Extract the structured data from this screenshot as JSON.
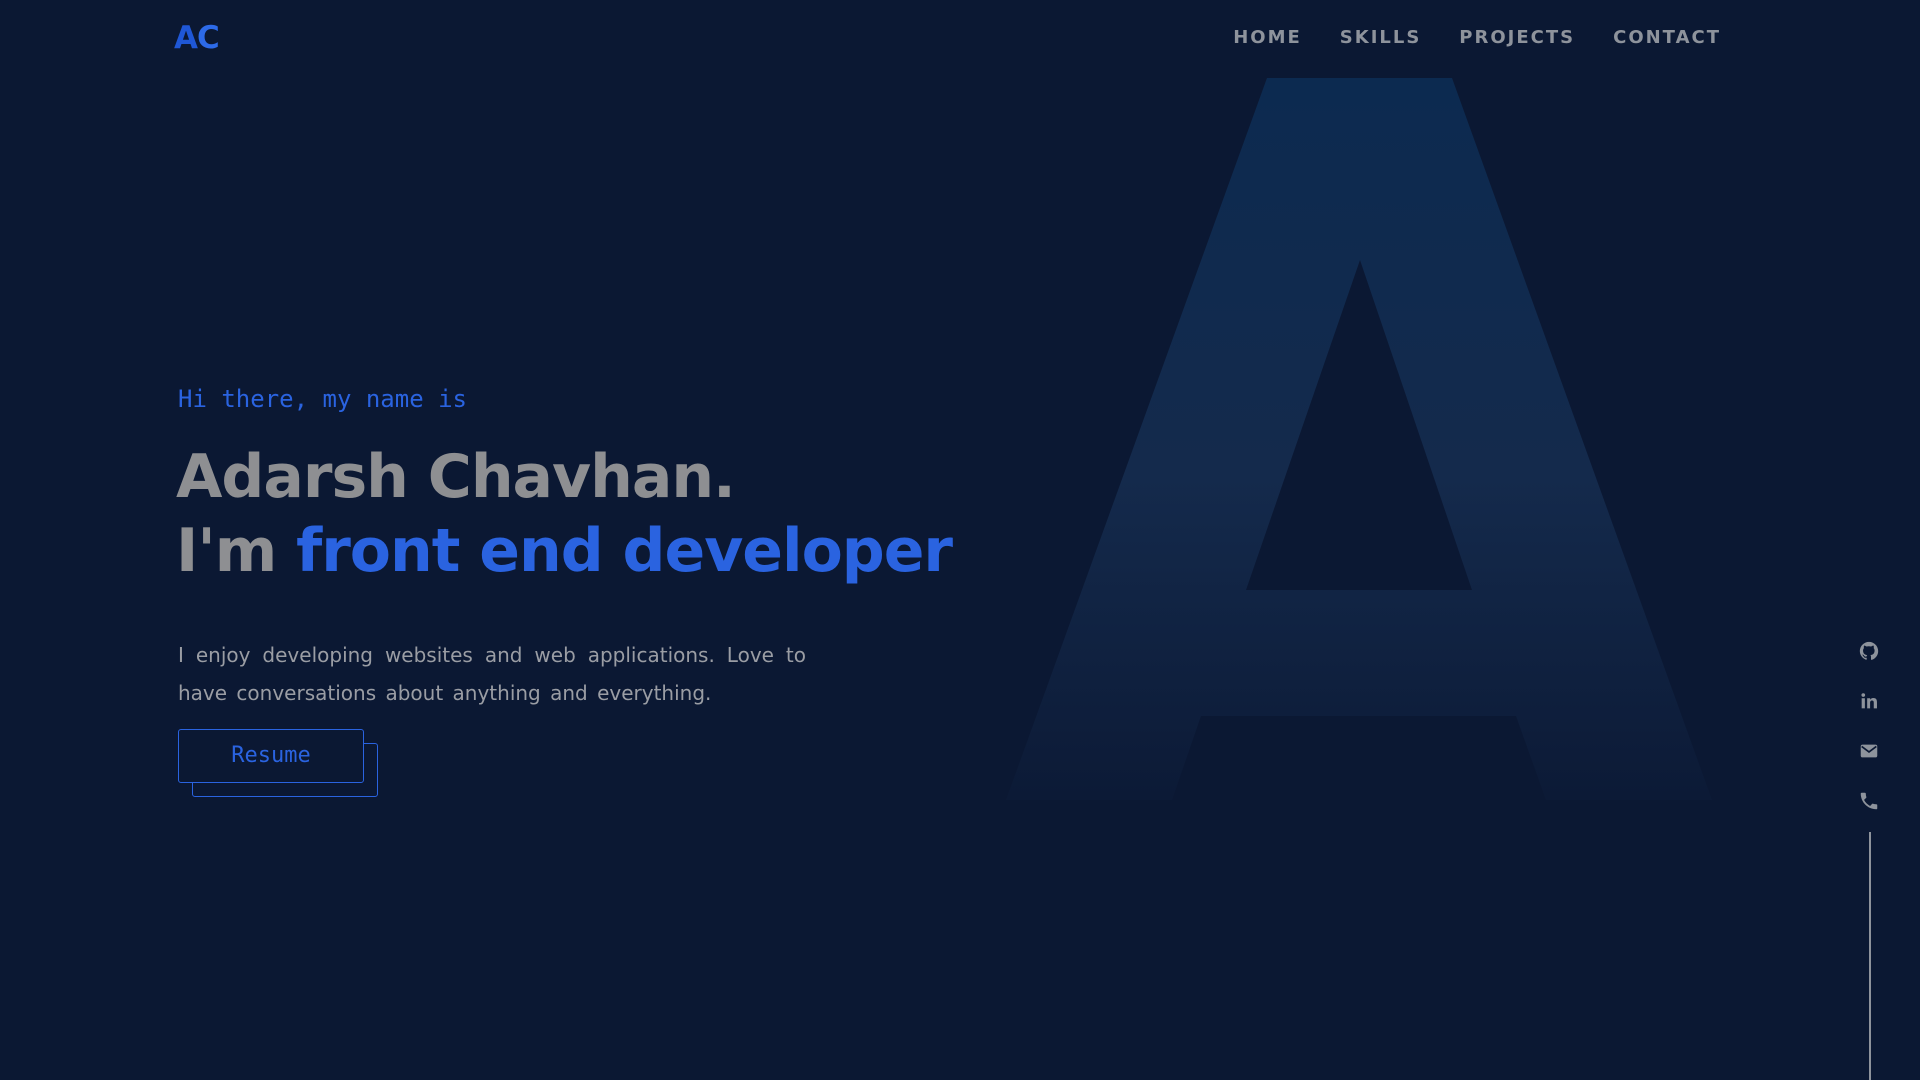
{
  "header": {
    "logo_first": "A",
    "logo_second": "C",
    "nav": [
      {
        "label": "HOME"
      },
      {
        "label": "SKILLS"
      },
      {
        "label": "PROJECTS"
      },
      {
        "label": "CONTACT"
      }
    ]
  },
  "hero": {
    "greeting": "Hi there, my name is",
    "name": "Adarsh Chavhan.",
    "role_prefix": "I'm ",
    "role_highlight": "front end developer",
    "bio": "I enjoy developing websites and web applications. Love to have conversations about anything and everything.",
    "resume_label": "Resume"
  },
  "background_letter": "A",
  "social": [
    {
      "icon": "github-icon"
    },
    {
      "icon": "linkedin-icon"
    },
    {
      "icon": "mail-icon"
    },
    {
      "icon": "phone-icon"
    }
  ],
  "colors": {
    "background": "#0b1833",
    "accent": "#2a63e0",
    "text_muted": "#8e939c",
    "heading": "#8e8f92"
  }
}
